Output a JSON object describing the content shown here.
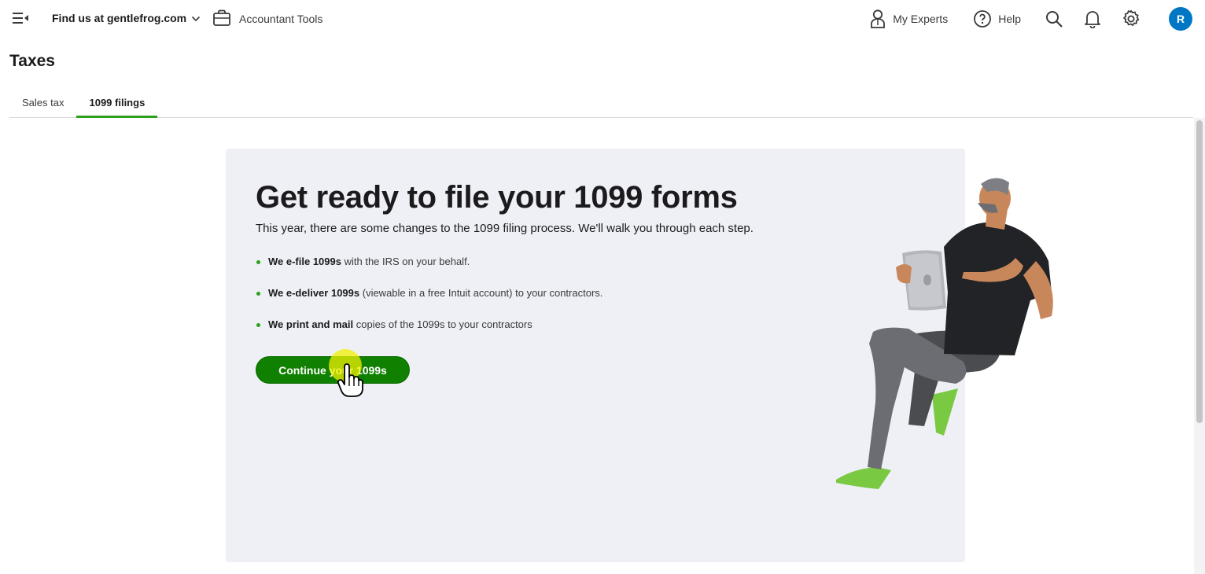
{
  "topbar": {
    "menu_icon": "menu-collapse-icon",
    "company_label": "Find us at gentlefrog.com",
    "accountant_tools_label": "Accountant Tools",
    "my_experts_label": "My Experts",
    "help_label": "Help",
    "avatar_initial": "R"
  },
  "page": {
    "title": "Taxes",
    "tabs": [
      {
        "label": "Sales tax",
        "active": false
      },
      {
        "label": "1099 filings",
        "active": true
      }
    ]
  },
  "card": {
    "headline": "Get ready to file your 1099 forms",
    "subhead": "This year, there are some changes to the 1099 filing process. We'll walk you through each step.",
    "bullets": [
      {
        "bold": "We e-file 1099s",
        "rest": " with the IRS on your behalf."
      },
      {
        "bold": "We e-deliver 1099s",
        "rest": " (viewable in a free Intuit account) to your contractors."
      },
      {
        "bold": "We print and mail",
        "rest": " copies of the 1099s to your contractors"
      }
    ],
    "cta_label": "Continue your 1099s"
  },
  "colors": {
    "accent_green": "#2ca01c",
    "button_green": "#108000",
    "avatar_blue": "#0077c5",
    "card_bg": "#eff0f5"
  }
}
